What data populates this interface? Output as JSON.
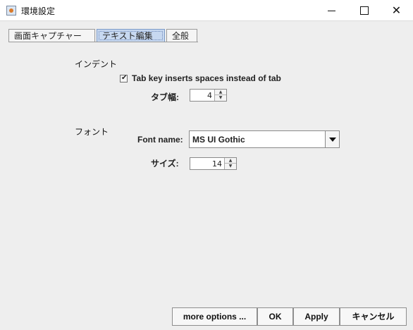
{
  "window": {
    "title": "環境設定",
    "controls": {
      "minimize": "",
      "maximize": "",
      "close": "✕"
    }
  },
  "tabs": [
    {
      "label": "画面キャプチャー",
      "selected": false
    },
    {
      "label": "テキスト編集",
      "selected": true
    },
    {
      "label": "全般",
      "selected": false
    }
  ],
  "sections": {
    "indent": "インデント",
    "font": "フォント"
  },
  "indent": {
    "checkbox_checked": true,
    "checkbox_mark": "✔",
    "checkbox_label": "Tab key inserts spaces instead of tab",
    "tab_width_label": "タブ幅:",
    "tab_width_value": "4"
  },
  "font": {
    "name_label": "Font name:",
    "name_value": "MS UI Gothic",
    "size_label": "サイズ:",
    "size_value": "14"
  },
  "buttons": {
    "more": "more options ...",
    "ok": "OK",
    "apply": "Apply",
    "cancel": "キャンセル"
  },
  "spinner_glyphs": {
    "up": "▲",
    "down": "▼"
  }
}
